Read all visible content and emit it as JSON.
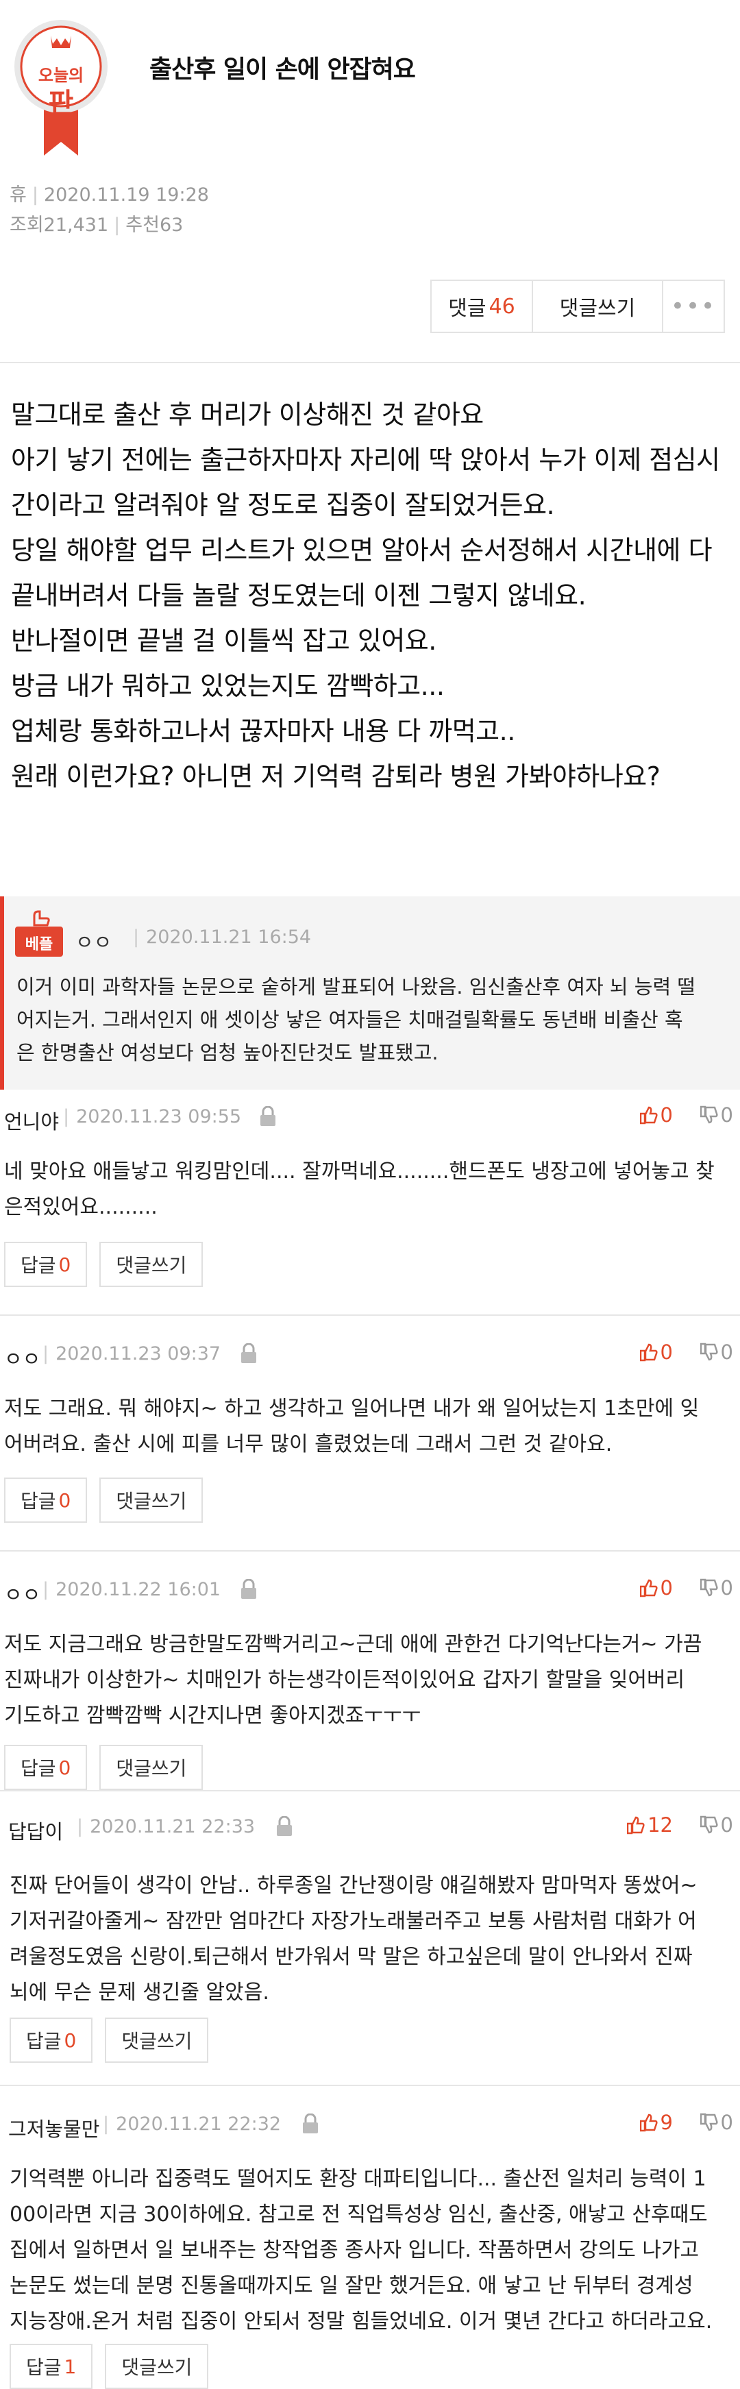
{
  "badge": {
    "line1": "오늘의",
    "line2": "판"
  },
  "post": {
    "title": "출산후 일이 손에 안잡혀요",
    "author": "휴",
    "datetime": "2020.11.19 19:28",
    "views": "조회21,431",
    "recommends": "추천63"
  },
  "actions": {
    "comments_label": "댓글",
    "comments_count": "46",
    "write_label": "댓글쓰기",
    "more_label": "•••"
  },
  "body_lines": [
    "말그대로 출산 후 머리가 이상해진 것 같아요",
    "아기 낳기 전에는 출근하자마자 자리에 딱 앉아서 누가 이제 점심시",
    "간이라고 알려줘야 알 정도로 집중이 잘되었거든요.",
    "당일 해야할 업무 리스트가 있으면 알아서 순서정해서 시간내에 다",
    "끝내버려서 다들 놀랄 정도였는데 이젠 그렇지 않네요.",
    "반나절이면 끝낼 걸 이틀씩 잡고 있어요.",
    "방금 내가 뭐하고 있었는지도 깜빡하고...",
    "업체랑 통화하고나서 끊자마자 내용 다 까먹고..",
    "원래 이런가요? 아니면 저 기억력 감퇴라 병원 가봐야하나요?"
  ],
  "best_comment": {
    "tag": "베플",
    "author": "ㅇㅇ",
    "date": "2020.11.21 16:54",
    "lines": [
      "이거 이미 과학자들 논문으로 숱하게 발표되어 나왔음. 임신출산후 여자 뇌 능력 떨",
      "어지는거. 그래서인지 애 셋이상 낳은 여자들은 치매걸릴확률도 동년배 비출산 혹",
      "은 한명출산 여성보다 엄청 높아진단것도 발표됐고."
    ]
  },
  "reply_label": "답글",
  "write_reply_label": "댓글쓰기",
  "comments": [
    {
      "author": "언니야",
      "date": "2020.11.23 09:55",
      "up": "0",
      "down": "0",
      "replies": "0",
      "lines": [
        "네 맞아요 애들낳고 워킹맘인데.... 잘까먹네요........핸드폰도 냉장고에 넣어놓고 찾",
        "은적있어요........."
      ]
    },
    {
      "author": "ㅇㅇ",
      "date": "2020.11.23 09:37",
      "up": "0",
      "down": "0",
      "replies": "0",
      "lines": [
        "저도 그래요. 뭐 해야지~ 하고 생각하고 일어나면 내가 왜 일어났는지 1초만에 잊",
        "어버려요. 출산 시에 피를 너무 많이 흘렸었는데 그래서 그런 것 같아요."
      ]
    },
    {
      "author": "ㅇㅇ",
      "date": "2020.11.22 16:01",
      "up": "0",
      "down": "0",
      "replies": "0",
      "lines": [
        "저도 지금그래요 방금한말도깜빡거리고~근데 애에 관한건 다기억난다는거~ 가끔",
        "진짜내가 이상한가~ 치매인가 하는생각이든적이있어요 갑자기 할말을 잊어버리",
        "기도하고 깜빡깜빡 시간지나면 좋아지겠죠ㅜㅜㅜ"
      ]
    },
    {
      "author": "답답이",
      "date": "2020.11.21 22:33",
      "up": "12",
      "down": "0",
      "replies": "0",
      "lines": [
        "진짜 단어들이 생각이 안남.. 하루종일 간난쟁이랑 얘길해봤자 맘마먹자 똥쌌어~",
        "기저귀갈아줄게~ 잠깐만 엄마간다 자장가노래불러주고 보통 사람처럼 대화가 어",
        "려울정도였음 신랑이.퇴근해서 반가워서 막 말은 하고싶은데 말이 안나와서 진짜",
        "뇌에 무슨 문제 생긴줄 알았음."
      ]
    },
    {
      "author": "그저놓물만",
      "date": "2020.11.21 22:32",
      "up": "9",
      "down": "0",
      "replies": "1",
      "lines": [
        "기억력뿐 아니라 집중력도 떨어지도 환장 대파티입니다... 출산전 일처리 능력이 1",
        "00이라면 지금 30이하에요. 참고로 전 직업특성상 임신, 출산중, 애낳고 산후때도",
        "집에서 일하면서 일 보내주는 창작업종 종사자 입니다. 작품하면서 강의도 나가고",
        "논문도 썼는데 분명 진통올때까지도 일 잘만 했거든요. 애 낳고 난 뒤부터 경계성",
        "지능장애.온거 처럼 집중이 안되서 정말 힘들었네요. 이거 몇년 간다고 하더라고요."
      ]
    }
  ],
  "colors": {
    "accent": "#e34a2a",
    "badge_red": "#e2452f"
  }
}
